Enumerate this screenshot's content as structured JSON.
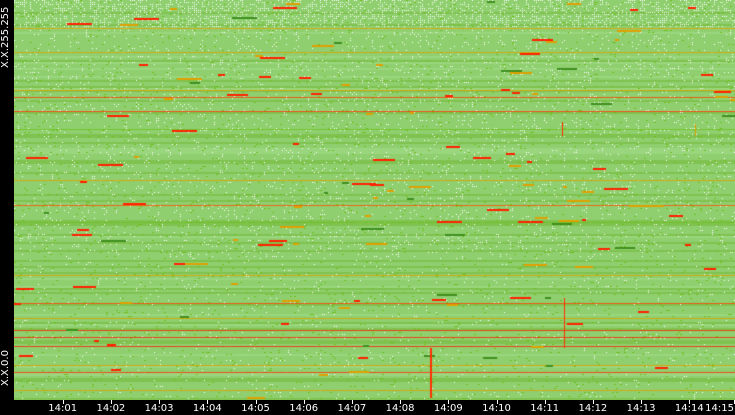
{
  "chart_data": {
    "type": "heatmap",
    "x_tick_labels": [
      "14:01",
      "14:02",
      "14:03",
      "14:04",
      "14:05",
      "14:06",
      "14:07",
      "14:08",
      "14:09",
      "14:10",
      "14:11",
      "14:12",
      "14:13",
      "14:14",
      "14:15"
    ],
    "y_tick_labels": {
      "top": "X.X.255.255",
      "bottom": "X.X.0.0"
    },
    "grid": false,
    "colors": {
      "background": "#000000",
      "empty": "#ffffff",
      "low": "#8fcf6f",
      "mid": "#6fbf1f",
      "high": "#e0a000",
      "peak": "#ff2000",
      "text": "#ffffff"
    }
  }
}
